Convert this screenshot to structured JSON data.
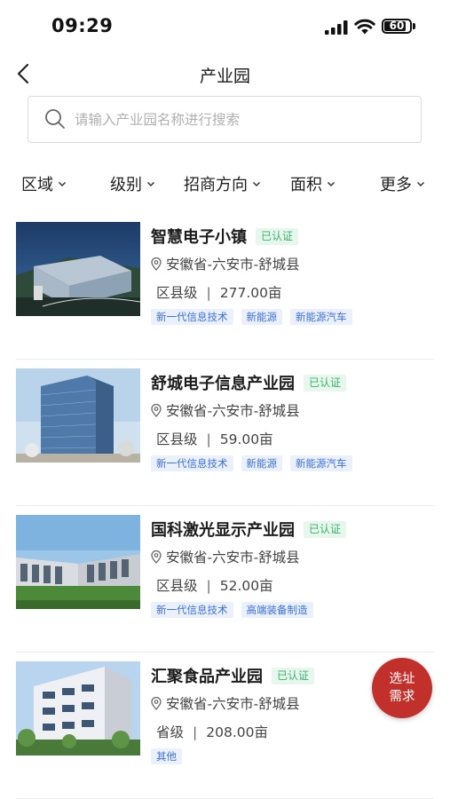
{
  "status_bar": {
    "time": "09:29",
    "battery": "60"
  },
  "nav": {
    "title": "产业园"
  },
  "search": {
    "placeholder": "请输入产业园名称进行搜索"
  },
  "filters": [
    "区域",
    "级别",
    "招商方向",
    "面积",
    "更多"
  ],
  "parks": [
    {
      "name": "智慧电子小镇",
      "verified": "已认证",
      "location": "安徽省-六安市-舒城县",
      "level": "区县级",
      "area": "277.00亩",
      "tags": [
        "新一代信息技术",
        "新能源",
        "新能源汽车"
      ]
    },
    {
      "name": "舒城电子信息产业园",
      "verified": "已认证",
      "location": "安徽省-六安市-舒城县",
      "level": "区县级",
      "area": "59.00亩",
      "tags": [
        "新一代信息技术",
        "新能源",
        "新能源汽车"
      ]
    },
    {
      "name": "国科激光显示产业园",
      "verified": "已认证",
      "location": "安徽省-六安市-舒城县",
      "level": "区县级",
      "area": "52.00亩",
      "tags": [
        "新一代信息技术",
        "高端装备制造"
      ]
    },
    {
      "name": "汇聚食品产业园",
      "verified": "已认证",
      "location": "安徽省-六安市-舒城县",
      "level": "省级",
      "area": "208.00亩",
      "tags": [
        "其他"
      ]
    }
  ],
  "fab": {
    "line1": "选址",
    "line2": "需求"
  },
  "colors": {
    "accent_red": "#c2302b",
    "verified_green": "#3bb36a",
    "tag_blue": "#3c6fd6"
  }
}
